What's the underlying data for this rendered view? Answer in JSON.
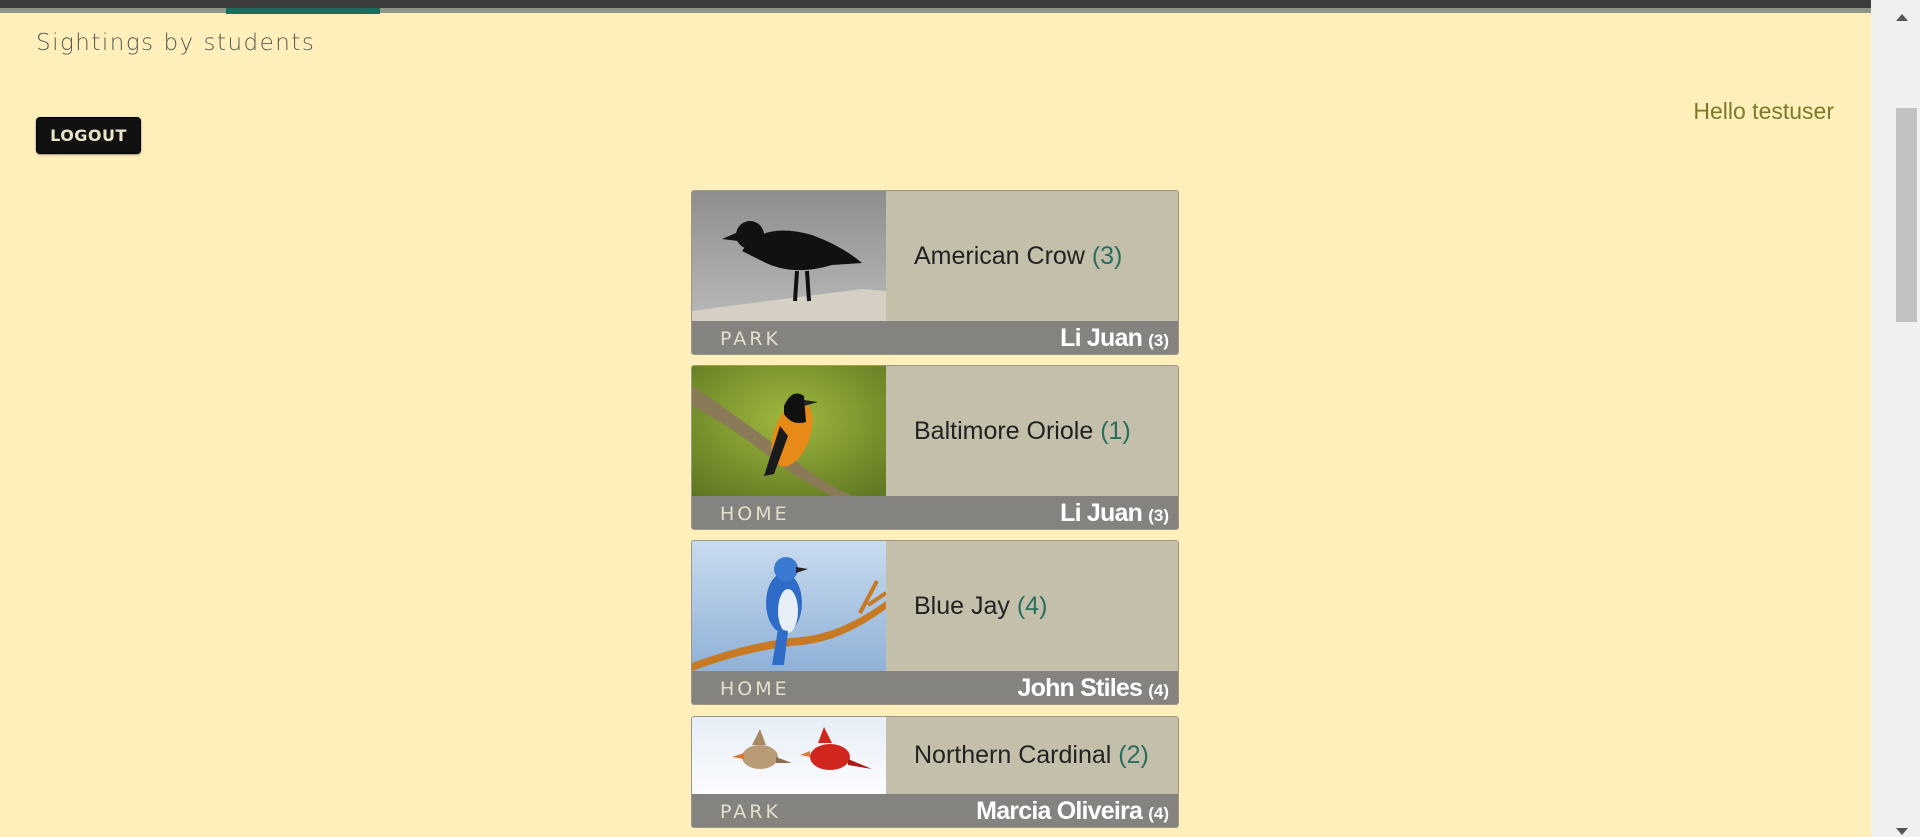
{
  "header": {
    "subtitle": "Sightings by students",
    "greeting": "Hello testuser",
    "logout_label": "LOGOUT"
  },
  "sightings": [
    {
      "bird": "American Crow",
      "bird_count": "(3)",
      "location": "PARK",
      "student": "Li Juan",
      "student_count": "(3)",
      "image_icon": "american-crow-photo"
    },
    {
      "bird": "Baltimore Oriole",
      "bird_count": "(1)",
      "location": "HOME",
      "student": "Li Juan",
      "student_count": "(3)",
      "image_icon": "baltimore-oriole-photo"
    },
    {
      "bird": "Blue Jay",
      "bird_count": "(4)",
      "location": "HOME",
      "student": "John Stiles",
      "student_count": "(4)",
      "image_icon": "blue-jay-photo"
    },
    {
      "bird": "Northern Cardinal",
      "bird_count": "(2)",
      "location": "PARK",
      "student": "Marcia Oliveira",
      "student_count": "(4)",
      "image_icon": "northern-cardinal-photo"
    }
  ],
  "colors": {
    "page_background": "#fff0bb",
    "card_background": "#c4bfaa",
    "card_footer": "#858380",
    "accent_tab": "#1c6b5b",
    "count_color": "#2a6e5e",
    "greeting_color": "#7a7a2a"
  }
}
